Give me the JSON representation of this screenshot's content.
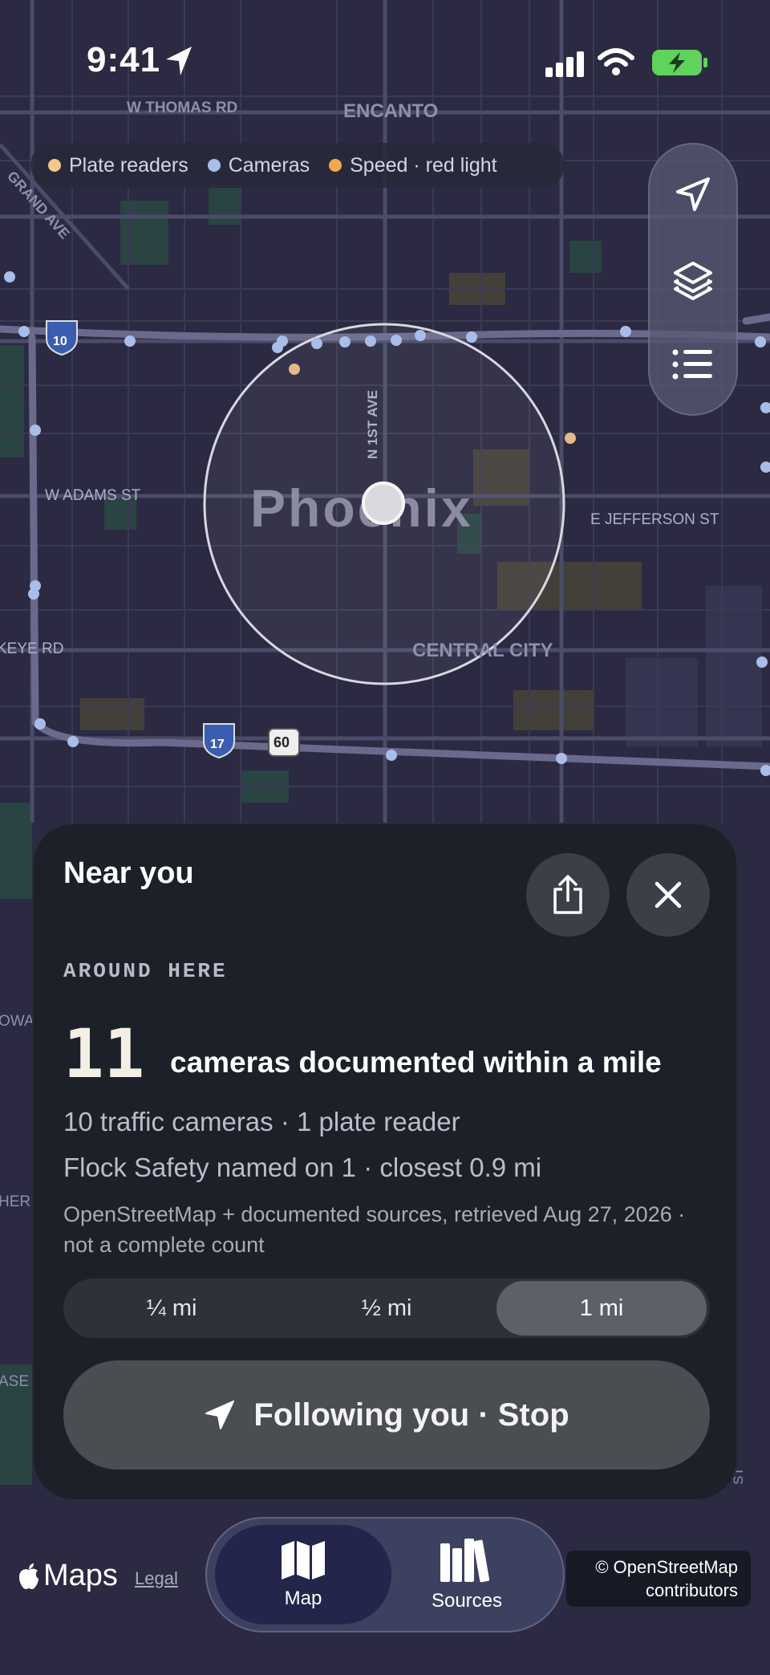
{
  "status_bar": {
    "time": "9:41"
  },
  "map": {
    "labels": {
      "thomas": "W THOMAS RD",
      "encanto": "ENCANTO",
      "grand": "GRAND AVE",
      "adams": "W ADAMS ST",
      "jefferson": "E JEFFERSON ST",
      "first_ave": "N 1ST AVE",
      "city": "Phoenix",
      "central": "CENTRAL CITY",
      "buckeye": "KEYE RD",
      "i10": "10",
      "i17": "17",
      "us60": "60",
      "edge_owa": "OWA",
      "edge_her": "HER",
      "edge_ase": "ASE",
      "edge_st": "ST"
    },
    "colors": {
      "plate": "#f3c98b",
      "camera": "#a9bde8",
      "speed": "#f2a84b"
    }
  },
  "legend": {
    "items": [
      {
        "label": "Plate readers",
        "color": "#f3c98b"
      },
      {
        "label": "Cameras",
        "color": "#a9bde8"
      },
      {
        "label": "Speed · red light",
        "color": "#f2a84b"
      }
    ]
  },
  "controls": {
    "icons": [
      "location-arrow-icon",
      "layers-icon",
      "list-icon"
    ]
  },
  "sheet": {
    "title": "Near you",
    "eyebrow": "AROUND HERE",
    "count": "11",
    "count_text": "cameras documented within a mile",
    "line1": "10 traffic cameras · 1 plate reader",
    "line2": "Flock Safety named on 1 · closest 0.9 mi",
    "note": "OpenStreetMap + documented sources, retrieved Aug 27, 2026 · not a complete count",
    "radius_options": [
      "¼ mi",
      "½ mi",
      "1 mi"
    ],
    "selected_radius": "1 mi",
    "follow_label": "Following you · Stop"
  },
  "footer": {
    "maps": "Maps",
    "legal": "Legal",
    "attribution_line1": "© OpenStreetMap",
    "attribution_line2": "contributors",
    "tabs": [
      {
        "label": "Map",
        "icon": "map-icon",
        "selected": true
      },
      {
        "label": "Sources",
        "icon": "books-icon",
        "selected": false
      }
    ]
  }
}
